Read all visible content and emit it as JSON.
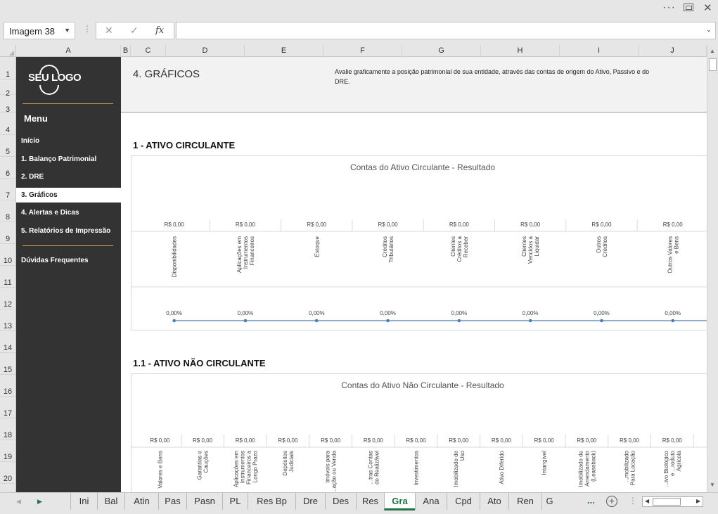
{
  "name_box": {
    "value": "Imagem 38"
  },
  "formula_bar": {
    "fx": "fx",
    "value": ""
  },
  "columns": [
    "A",
    "B",
    "C",
    "D",
    "E",
    "F",
    "G",
    "H",
    "I",
    "J"
  ],
  "rows": [
    "1",
    "2",
    "3",
    "4",
    "5",
    "6",
    "7",
    "8",
    "9",
    "10",
    "11",
    "12",
    "13",
    "14",
    "15",
    "16",
    "17",
    "18",
    "19",
    "20"
  ],
  "sidebar": {
    "logo_text": "SEU LOGO",
    "menu_title": "Menu",
    "items": [
      {
        "label": "Início",
        "active": false
      },
      {
        "label": "1. Balanço Patrimonial",
        "active": false
      },
      {
        "label": "2. DRE",
        "active": false
      },
      {
        "label": "3. Gráficos",
        "active": true
      },
      {
        "label": "4. Alertas e Dicas",
        "active": false
      },
      {
        "label": "5. Relatórios de Impressão",
        "active": false
      },
      {
        "label": "Dúvidas Frequentes",
        "active": false
      }
    ],
    "accent_color": "#c8a060"
  },
  "header": {
    "title": "4. GRÁFICOS",
    "description": "Avalie graficamente a posição patrimonial de sua entidade, através das contas de origem do Ativo, Passivo e do DRE."
  },
  "sections": [
    {
      "title": "1 - ATIVO CIRCULANTE"
    },
    {
      "title": "1.1 - ATIVO NÃO CIRCULANTE"
    }
  ],
  "chart_data": [
    {
      "type": "table",
      "title": "Contas do Ativo Circulante - Resultado",
      "categories": [
        "Disponibilidades",
        "Aplicações em Instrumentos Financeiros",
        "Estoque",
        "Créditos Tributários",
        "Clientes Créditos a Receber",
        "Clientes Vencidos a Liquidar",
        "Outros Créditos",
        "Outros Valores e Bens"
      ],
      "values": [
        0,
        0,
        0,
        0,
        0,
        0,
        0,
        0
      ],
      "value_labels": [
        "R$ 0,00",
        "R$ 0,00",
        "R$ 0,00",
        "R$ 0,00",
        "R$ 0,00",
        "R$ 0,00",
        "R$ 0,00",
        "R$ 0,00"
      ],
      "series": [
        {
          "type": "line",
          "values": [
            0,
            0,
            0,
            0,
            0,
            0,
            0,
            0
          ],
          "labels": [
            "0,00%",
            "0,00%",
            "0,00%",
            "0,00%",
            "0,00%",
            "0,00%",
            "0,00%",
            "0,00%"
          ]
        }
      ],
      "line_color": "#4a7ebb"
    },
    {
      "type": "table",
      "title": "Contas do Ativo Não Circulante - Resultado",
      "categories": [
        "Valores e Bens",
        "Garantias e Cauções",
        "Aplicações em Instrumentos Financeiros a Longo Prazo",
        "Depósitos Judiciais",
        "Imóveis para ...ação ou Venda",
        "...tras Contas do Realizável",
        "Investimentos",
        "Imobilizado de Uso",
        "Ativo Diferido",
        "Intangível",
        "Imobilizado de Arrendamento (Leaseback)",
        "...mobilizado Para Locação",
        "...ivo Biológico e ...roduto Agrícola"
      ],
      "values": [
        0,
        0,
        0,
        0,
        0,
        0,
        0,
        0,
        0,
        0,
        0,
        0,
        0
      ],
      "value_labels": [
        "R$ 0,00",
        "R$ 0,00",
        "R$ 0,00",
        "R$ 0,00",
        "R$ 0,00",
        "R$ 0,00",
        "R$ 0,00",
        "R$ 0,00",
        "R$ 0,00",
        "R$ 0,00",
        "R$ 0,00",
        "R$ 0,00",
        "R$ 0,00"
      ]
    }
  ],
  "sheet_tabs": [
    {
      "label": "Ini",
      "active": false
    },
    {
      "label": "Bal",
      "active": false
    },
    {
      "label": "Atin",
      "active": false
    },
    {
      "label": "Pas",
      "active": false
    },
    {
      "label": "Pasn",
      "active": false
    },
    {
      "label": "PL",
      "active": false
    },
    {
      "label": "Res Bp",
      "active": false
    },
    {
      "label": "Dre",
      "active": false
    },
    {
      "label": "Des",
      "active": false
    },
    {
      "label": "Res",
      "active": false
    },
    {
      "label": "Gra",
      "active": true
    },
    {
      "label": "Ana",
      "active": false
    },
    {
      "label": "Cpd",
      "active": false
    },
    {
      "label": "Ato",
      "active": false
    },
    {
      "label": "Ren",
      "active": false
    },
    {
      "label": "G",
      "active": false
    }
  ],
  "tab_more": "...",
  "excel_green": "#217346"
}
